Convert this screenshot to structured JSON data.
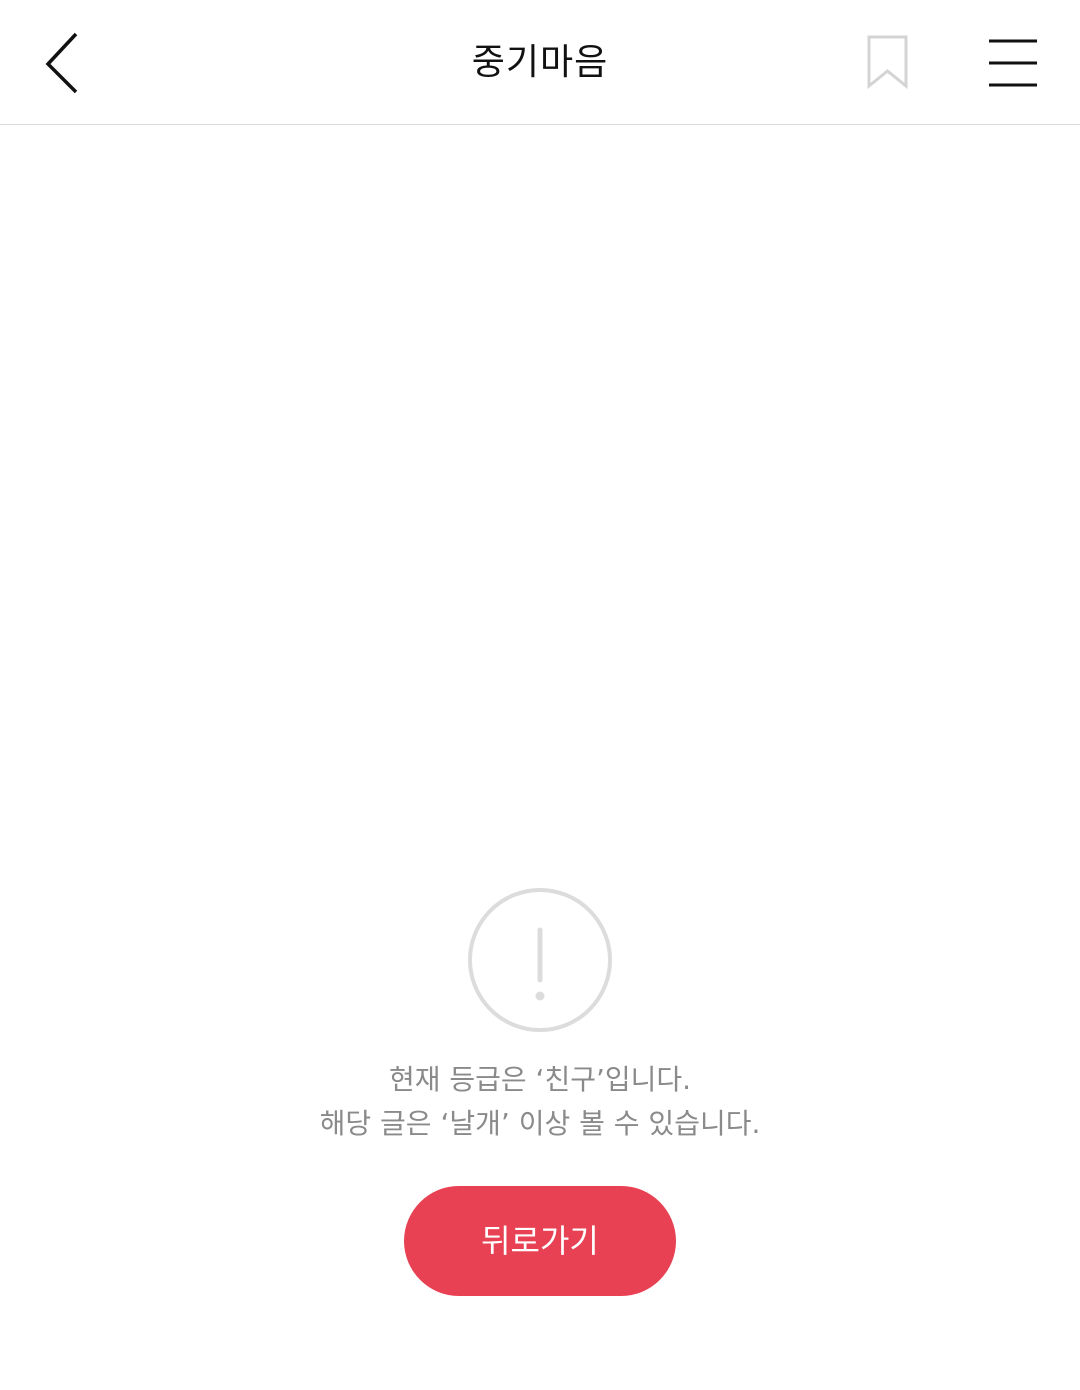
{
  "header": {
    "back_icon": "chevron-left-icon",
    "title": "중기마음",
    "bookmark_icon": "bookmark-icon",
    "menu_icon": "hamburger-menu-icon"
  },
  "notice": {
    "icon": "exclamation-circle-icon",
    "line1": "현재 등급은 ‘친구’입니다.",
    "line2": "해당 글은 ‘날개’ 이상 볼 수 있습니다.",
    "button_label": "뒤로가기"
  },
  "colors": {
    "accent": "#e84153",
    "muted_text": "#8a8a8a",
    "icon_gray": "#dcdcdc"
  }
}
